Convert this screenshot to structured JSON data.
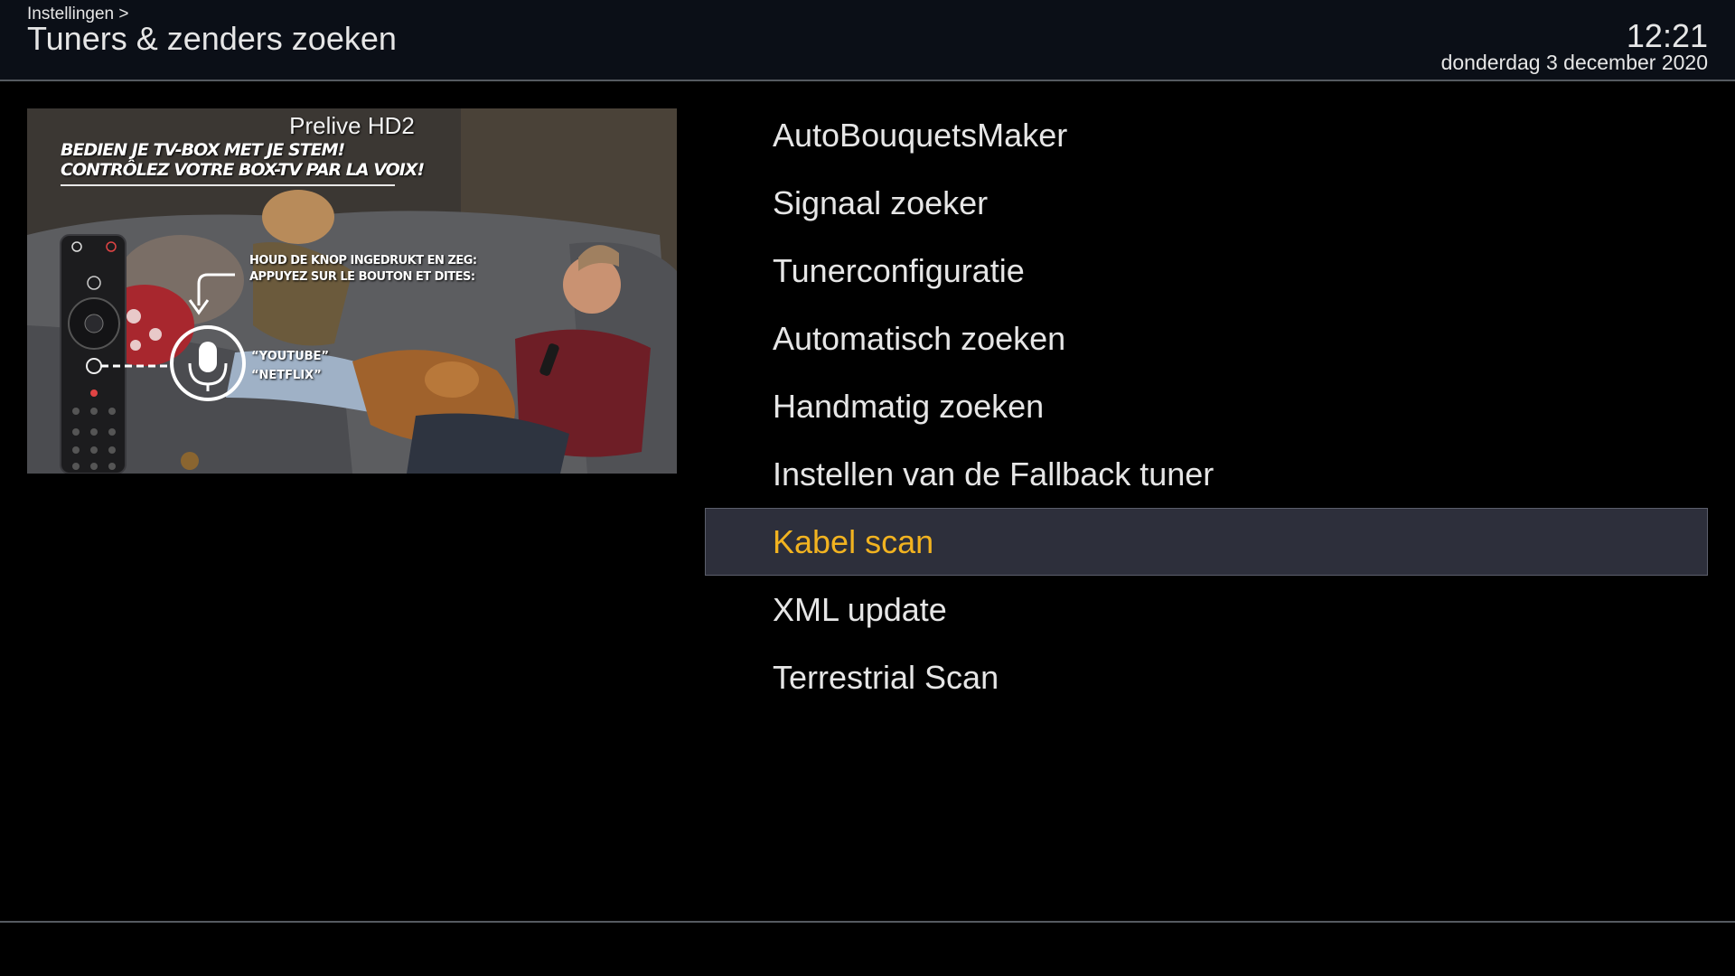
{
  "header": {
    "breadcrumb": "Instellingen >",
    "title": "Tuners & zenders zoeken",
    "time": "12:21",
    "date": "donderdag 3 december 2020"
  },
  "preview": {
    "channel_name": "Prelive HD2",
    "promo_line1": "BEDIEN JE TV-BOX MET JE STEM!",
    "promo_line2": "CONTRÔLEZ VOTRE BOX-TV PAR LA VOIX!",
    "instruction_line1": "HOUD DE KNOP INGEDRUKT EN ZEG:",
    "instruction_line2": "APPUYEZ SUR LE BOUTON ET DITES:",
    "voice_command1": "“YOUTUBE”",
    "voice_command2": "“NETFLIX”"
  },
  "menu": {
    "selected_index": 6,
    "items": [
      {
        "label": "AutoBouquetsMaker"
      },
      {
        "label": "Signaal zoeker"
      },
      {
        "label": "Tunerconfiguratie"
      },
      {
        "label": "Automatisch zoeken"
      },
      {
        "label": "Handmatig zoeken"
      },
      {
        "label": "Instellen van de Fallback tuner"
      },
      {
        "label": "Kabel scan"
      },
      {
        "label": "XML update"
      },
      {
        "label": "Terrestrial Scan"
      }
    ]
  },
  "colors": {
    "background": "#000000",
    "header_bg": "#0b0f17",
    "text": "#e6e6e6",
    "selected_text": "#f2b320",
    "selected_bg": "#2d2f3b",
    "divider": "#555a60"
  }
}
